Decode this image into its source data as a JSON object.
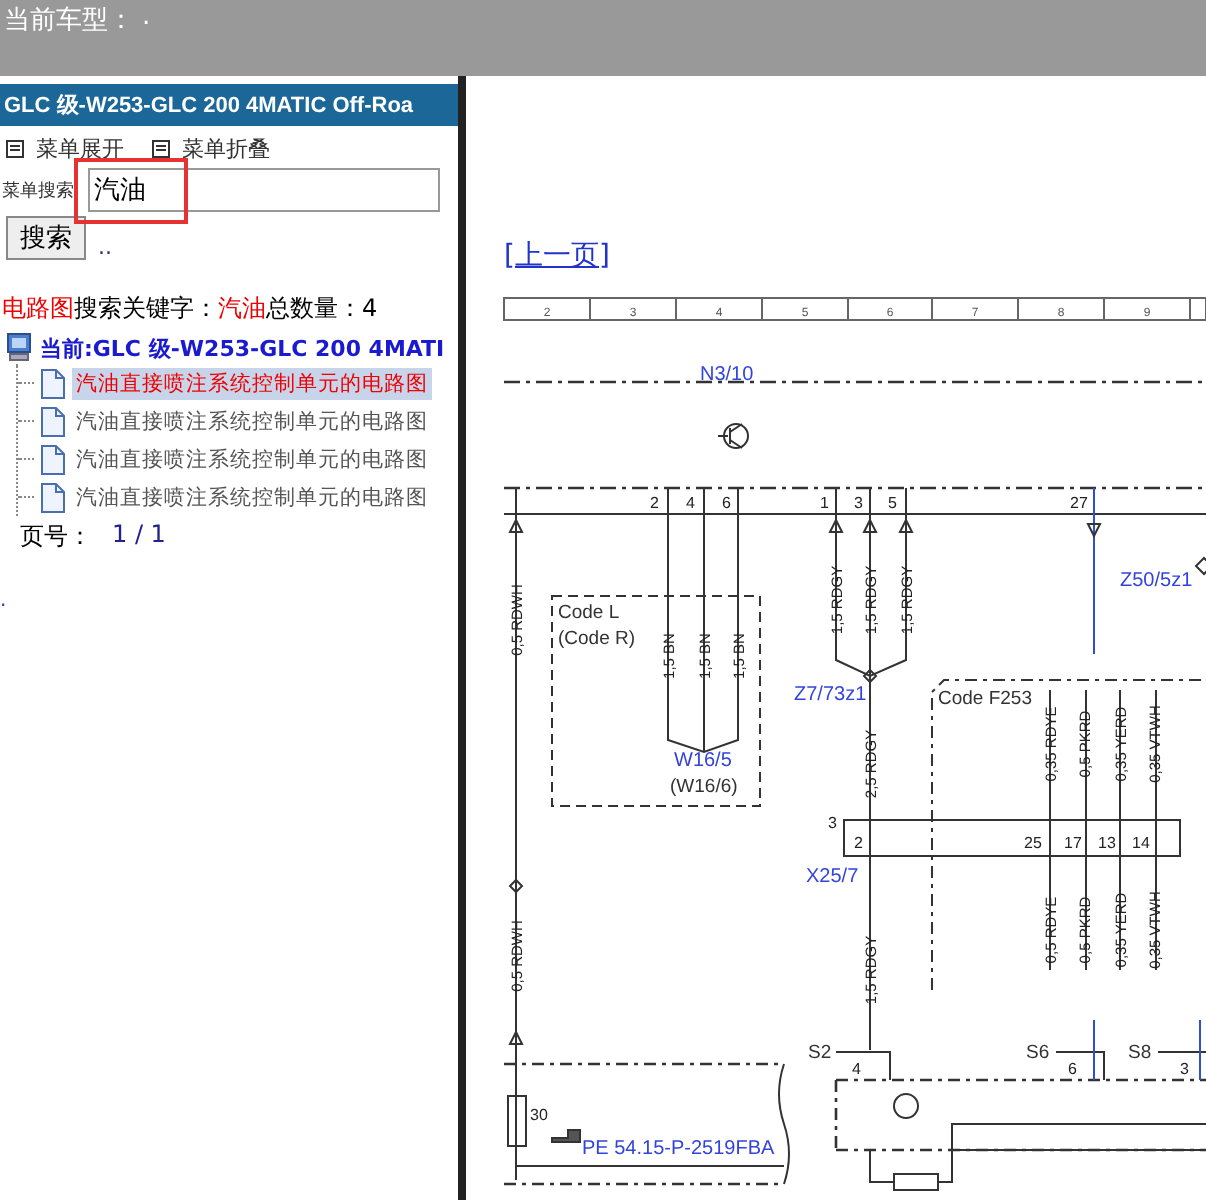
{
  "header": {
    "label": "当前车型：",
    "value": "."
  },
  "sidebar": {
    "title": "GLC 级-W253-GLC 200 4MATIC Off-Roa",
    "menu_actions": [
      {
        "label": "菜单展开"
      },
      {
        "label": "菜单折叠"
      }
    ],
    "search": {
      "label": "菜单搜索",
      "value": "汽油",
      "highlighted": true,
      "button": "搜索",
      "extra": ".."
    },
    "results": {
      "category": "电路图",
      "keyword_label": "搜索关键字：",
      "keyword": "汽油",
      "count_label": "总数量：",
      "count": "4"
    },
    "tree": {
      "root": "当前:GLC 级-W253-GLC 200 4MATI",
      "children": [
        {
          "label": "汽油直接喷注系统控制单元的电路图",
          "selected": true
        },
        {
          "label": "汽油直接喷注系统控制单元的电路图",
          "selected": false
        },
        {
          "label": "汽油直接喷注系统控制单元的电路图",
          "selected": false
        },
        {
          "label": "汽油直接喷注系统控制单元的电路图",
          "selected": false
        }
      ]
    },
    "pager": {
      "label": "页号：",
      "value": "1 / 1"
    },
    "footer_mark": "."
  },
  "content": {
    "prev_link": "[上一页]",
    "diagram": {
      "grid_columns": [
        "2",
        "3",
        "4",
        "5",
        "6",
        "7",
        "8",
        "9"
      ],
      "labels": [
        {
          "text": "N3/10",
          "kind": "component"
        },
        {
          "text": "2",
          "kind": "pin"
        },
        {
          "text": "4",
          "kind": "pin"
        },
        {
          "text": "6",
          "kind": "pin"
        },
        {
          "text": "1",
          "kind": "pin"
        },
        {
          "text": "3",
          "kind": "pin"
        },
        {
          "text": "5",
          "kind": "pin"
        },
        {
          "text": "27",
          "kind": "pin"
        },
        {
          "text": "0,5 RDWH",
          "kind": "wire"
        },
        {
          "text": "1,5 BN",
          "kind": "wire"
        },
        {
          "text": "1,5 BN",
          "kind": "wire"
        },
        {
          "text": "1,5 BN",
          "kind": "wire"
        },
        {
          "text": "1,5 RDGY",
          "kind": "wire"
        },
        {
          "text": "1,5 RDGY",
          "kind": "wire"
        },
        {
          "text": "1,5 RDGY",
          "kind": "wire"
        },
        {
          "text": "Z50/5z1",
          "kind": "component"
        },
        {
          "text": "Code L",
          "kind": "note"
        },
        {
          "text": "(Code R)",
          "kind": "note"
        },
        {
          "text": "W16/5",
          "kind": "component"
        },
        {
          "text": "(W16/6)",
          "kind": "note"
        },
        {
          "text": "Z7/73z1",
          "kind": "component"
        },
        {
          "text": "Code F253",
          "kind": "note"
        },
        {
          "text": "0,35 RDYE",
          "kind": "wire"
        },
        {
          "text": "0,5 PKRD",
          "kind": "wire"
        },
        {
          "text": "0,35 YERD",
          "kind": "wire"
        },
        {
          "text": "0,35 VTWH",
          "kind": "wire"
        },
        {
          "text": "2,5 RDGY",
          "kind": "wire"
        },
        {
          "text": "3",
          "kind": "pin"
        },
        {
          "text": "2",
          "kind": "pin"
        },
        {
          "text": "25",
          "kind": "pin"
        },
        {
          "text": "17",
          "kind": "pin"
        },
        {
          "text": "13",
          "kind": "pin"
        },
        {
          "text": "14",
          "kind": "pin"
        },
        {
          "text": "X25/7",
          "kind": "component"
        },
        {
          "text": "0,5 RDYE",
          "kind": "wire"
        },
        {
          "text": "0,5 PKRD",
          "kind": "wire"
        },
        {
          "text": "0,35 YERD",
          "kind": "wire"
        },
        {
          "text": "0,35 VTWH",
          "kind": "wire"
        },
        {
          "text": "0,5 RDWH",
          "kind": "wire"
        },
        {
          "text": "1,5 RDGY",
          "kind": "wire"
        },
        {
          "text": "S2",
          "kind": "note"
        },
        {
          "text": "S6",
          "kind": "note"
        },
        {
          "text": "S8",
          "kind": "note"
        },
        {
          "text": "4",
          "kind": "pin"
        },
        {
          "text": "6",
          "kind": "pin"
        },
        {
          "text": "3",
          "kind": "pin"
        },
        {
          "text": "30",
          "kind": "pin"
        },
        {
          "text": "PE 54.15-P-2519FBA",
          "kind": "component"
        }
      ]
    }
  }
}
